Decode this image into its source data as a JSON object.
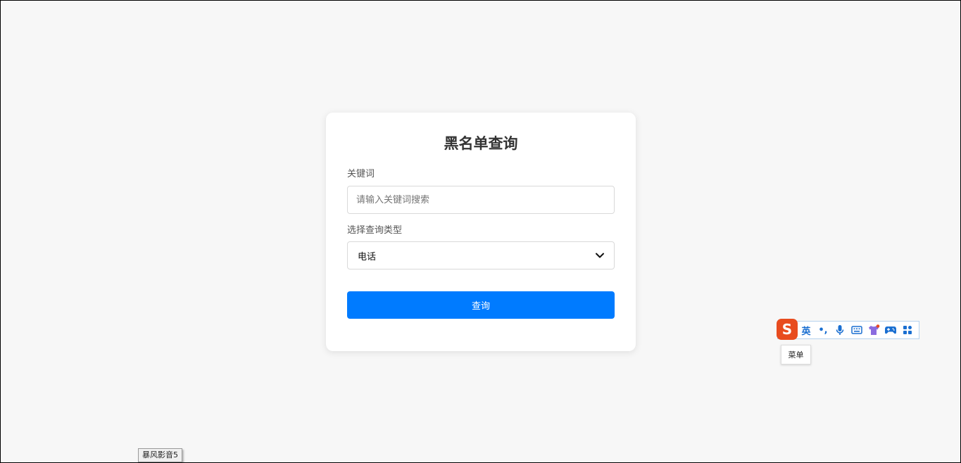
{
  "card": {
    "title": "黑名单查询",
    "keyword_label": "关键词",
    "keyword_placeholder": "请输入关键词搜索",
    "keyword_value": "",
    "type_label": "选择查询类型",
    "type_selected": "电话",
    "submit_label": "查询"
  },
  "ime": {
    "logo_letter": "S",
    "mode_label": "英",
    "punct_label": "•,",
    "icons": [
      "microphone-icon",
      "keyboard-icon",
      "skin-shirt-icon",
      "gamepad-icon",
      "toolbox-grid-icon"
    ],
    "tooltip": "菜单"
  },
  "taskbar": {
    "app_label": "暴风影音5"
  },
  "colors": {
    "primary": "#007bff",
    "page_bg": "#f7f7f7",
    "ime_logo": "#e84c1f",
    "ime_icon": "#1a6fd1"
  }
}
